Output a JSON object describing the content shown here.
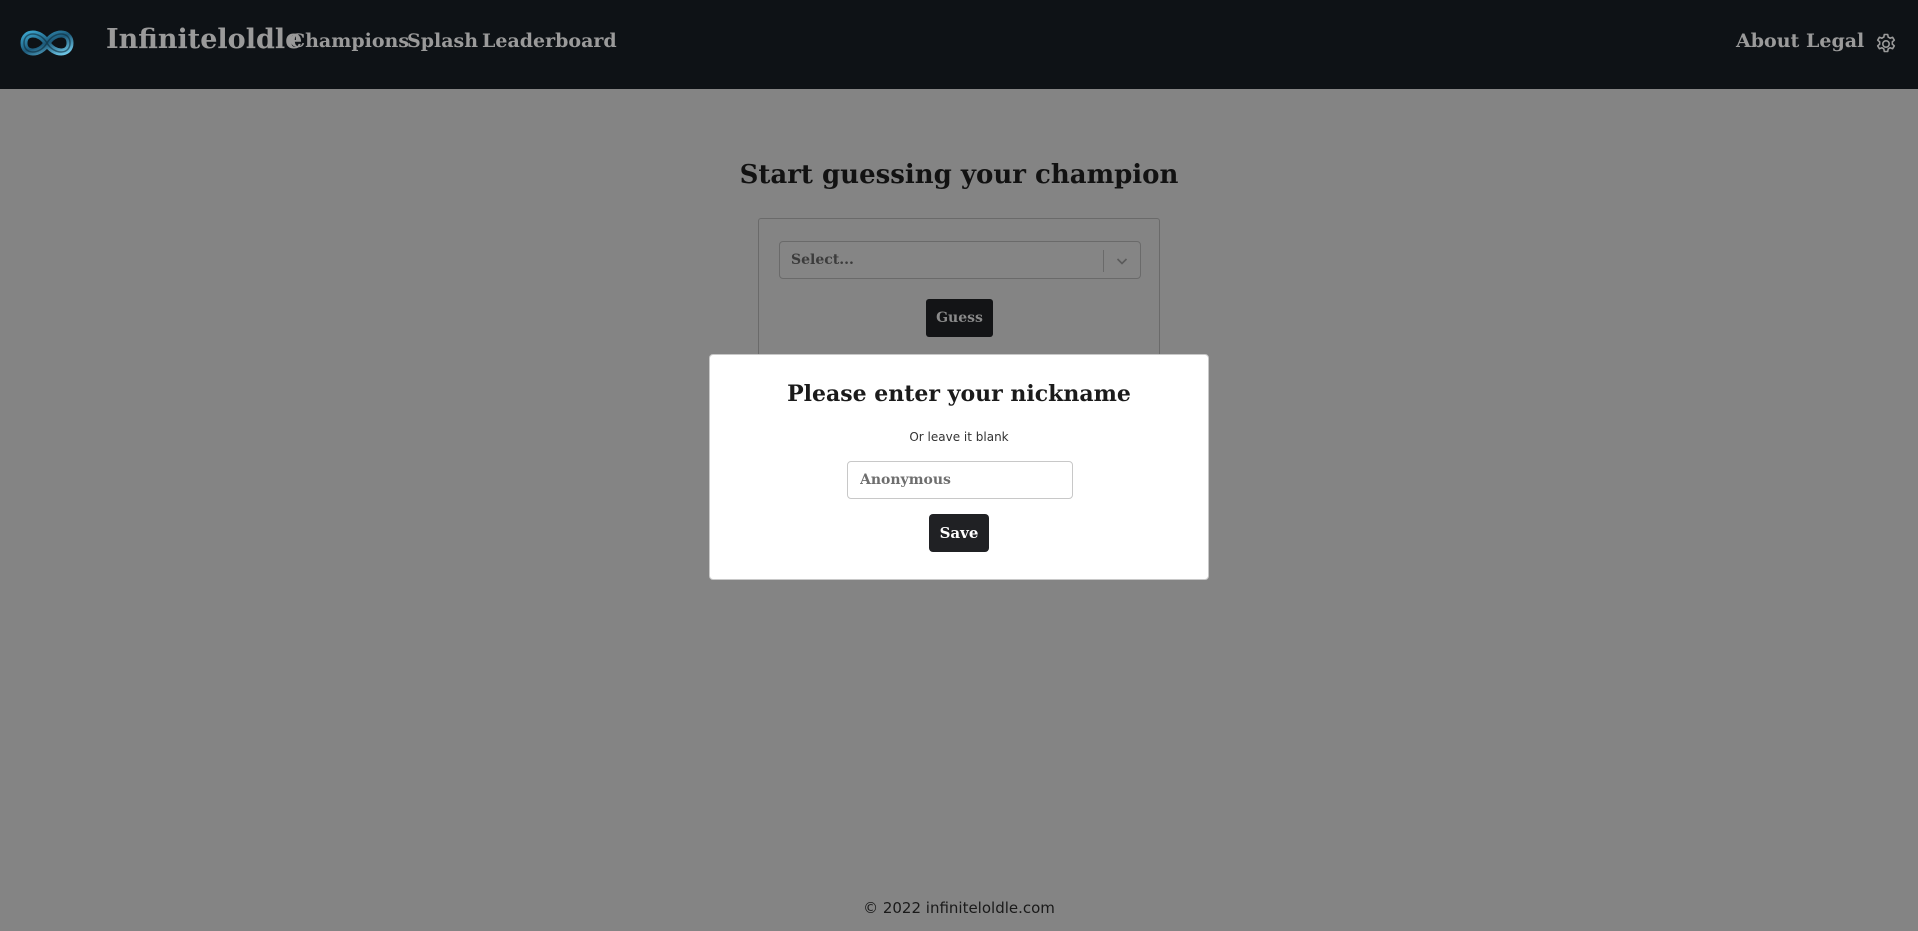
{
  "nav": {
    "brand": "Infiniteloldle",
    "links": {
      "champions": "Champions",
      "splash": "Splash",
      "leaderboard": "Leaderboard",
      "about": "About",
      "legal": "Legal"
    },
    "logo_icon": "infinity-icon",
    "settings_icon": "gear-icon"
  },
  "main": {
    "title": "Start guessing your champion",
    "select": {
      "placeholder": "Select...",
      "chevron_icon": "chevron-down-icon"
    },
    "guess_label": "Guess"
  },
  "modal": {
    "title": "Please enter your nickname",
    "subtitle": "Or leave it blank",
    "input": {
      "value": "",
      "placeholder": "Anonymous"
    },
    "save_label": "Save"
  },
  "footer": {
    "text": "© 2022 infiniteloldle.com"
  },
  "colors": {
    "navbar": "#0e1216",
    "overlay_background": "#848484",
    "button_dark": "#202124",
    "modal_background": "#ffffff"
  }
}
